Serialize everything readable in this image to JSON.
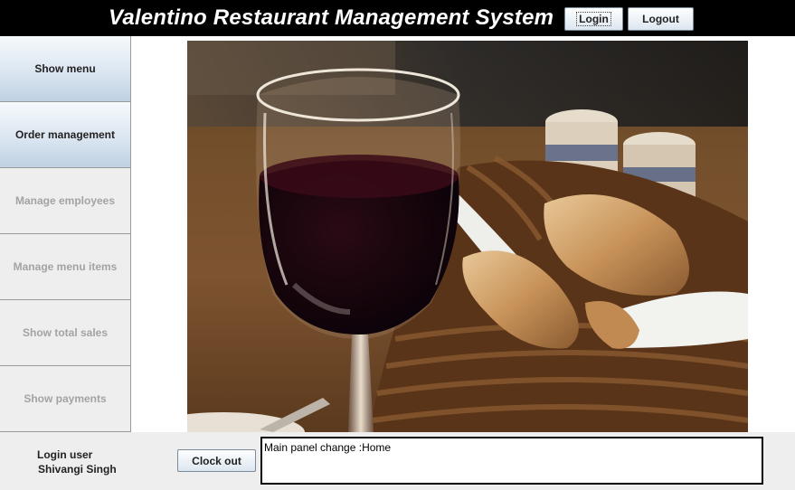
{
  "header": {
    "title": "Valentino Restaurant Management System",
    "login_label": "Login",
    "logout_label": "Logout"
  },
  "sidebar": {
    "items": [
      {
        "label": "Show menu",
        "enabled": true
      },
      {
        "label": "Order management",
        "enabled": true
      },
      {
        "label": "Manage employees",
        "enabled": false
      },
      {
        "label": "Manage menu items",
        "enabled": false
      },
      {
        "label": "Show total sales",
        "enabled": false
      },
      {
        "label": "Show payments",
        "enabled": false
      }
    ]
  },
  "main": {
    "image_subject": "glass of red wine with bread basket and salt shakers on restaurant table"
  },
  "footer": {
    "login_label": "Login user",
    "login_user": "Shivangi Singh",
    "clock_out_label": "Clock out",
    "status_text": "Main panel change :Home"
  },
  "colors": {
    "header_bg": "#000000",
    "header_text": "#ffffff",
    "active_button_gradient_end": "#bfd1e3",
    "disabled_text": "#a3a3a3",
    "panel_bg": "#eeeeee"
  }
}
